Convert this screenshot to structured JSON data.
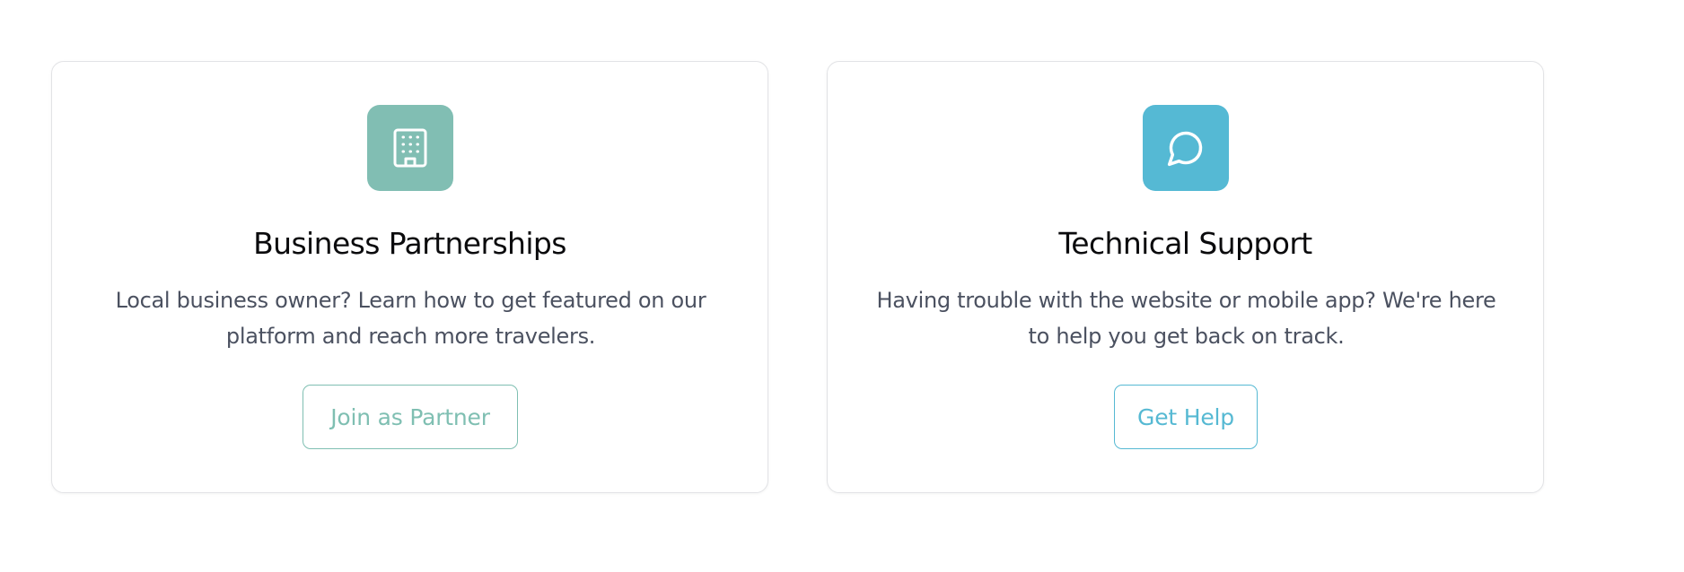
{
  "cards": [
    {
      "title": "Business Partnerships",
      "description": "Local business owner? Learn how to get featured on our platform and reach more travelers.",
      "button_label": "Join as Partner",
      "icon": "building-icon",
      "accent_color": "#81beb3"
    },
    {
      "title": "Technical Support",
      "description": "Having trouble with the website or mobile app? We're here to help you get back on track.",
      "button_label": "Get Help",
      "icon": "message-circle-icon",
      "accent_color": "#55b9d4"
    }
  ]
}
